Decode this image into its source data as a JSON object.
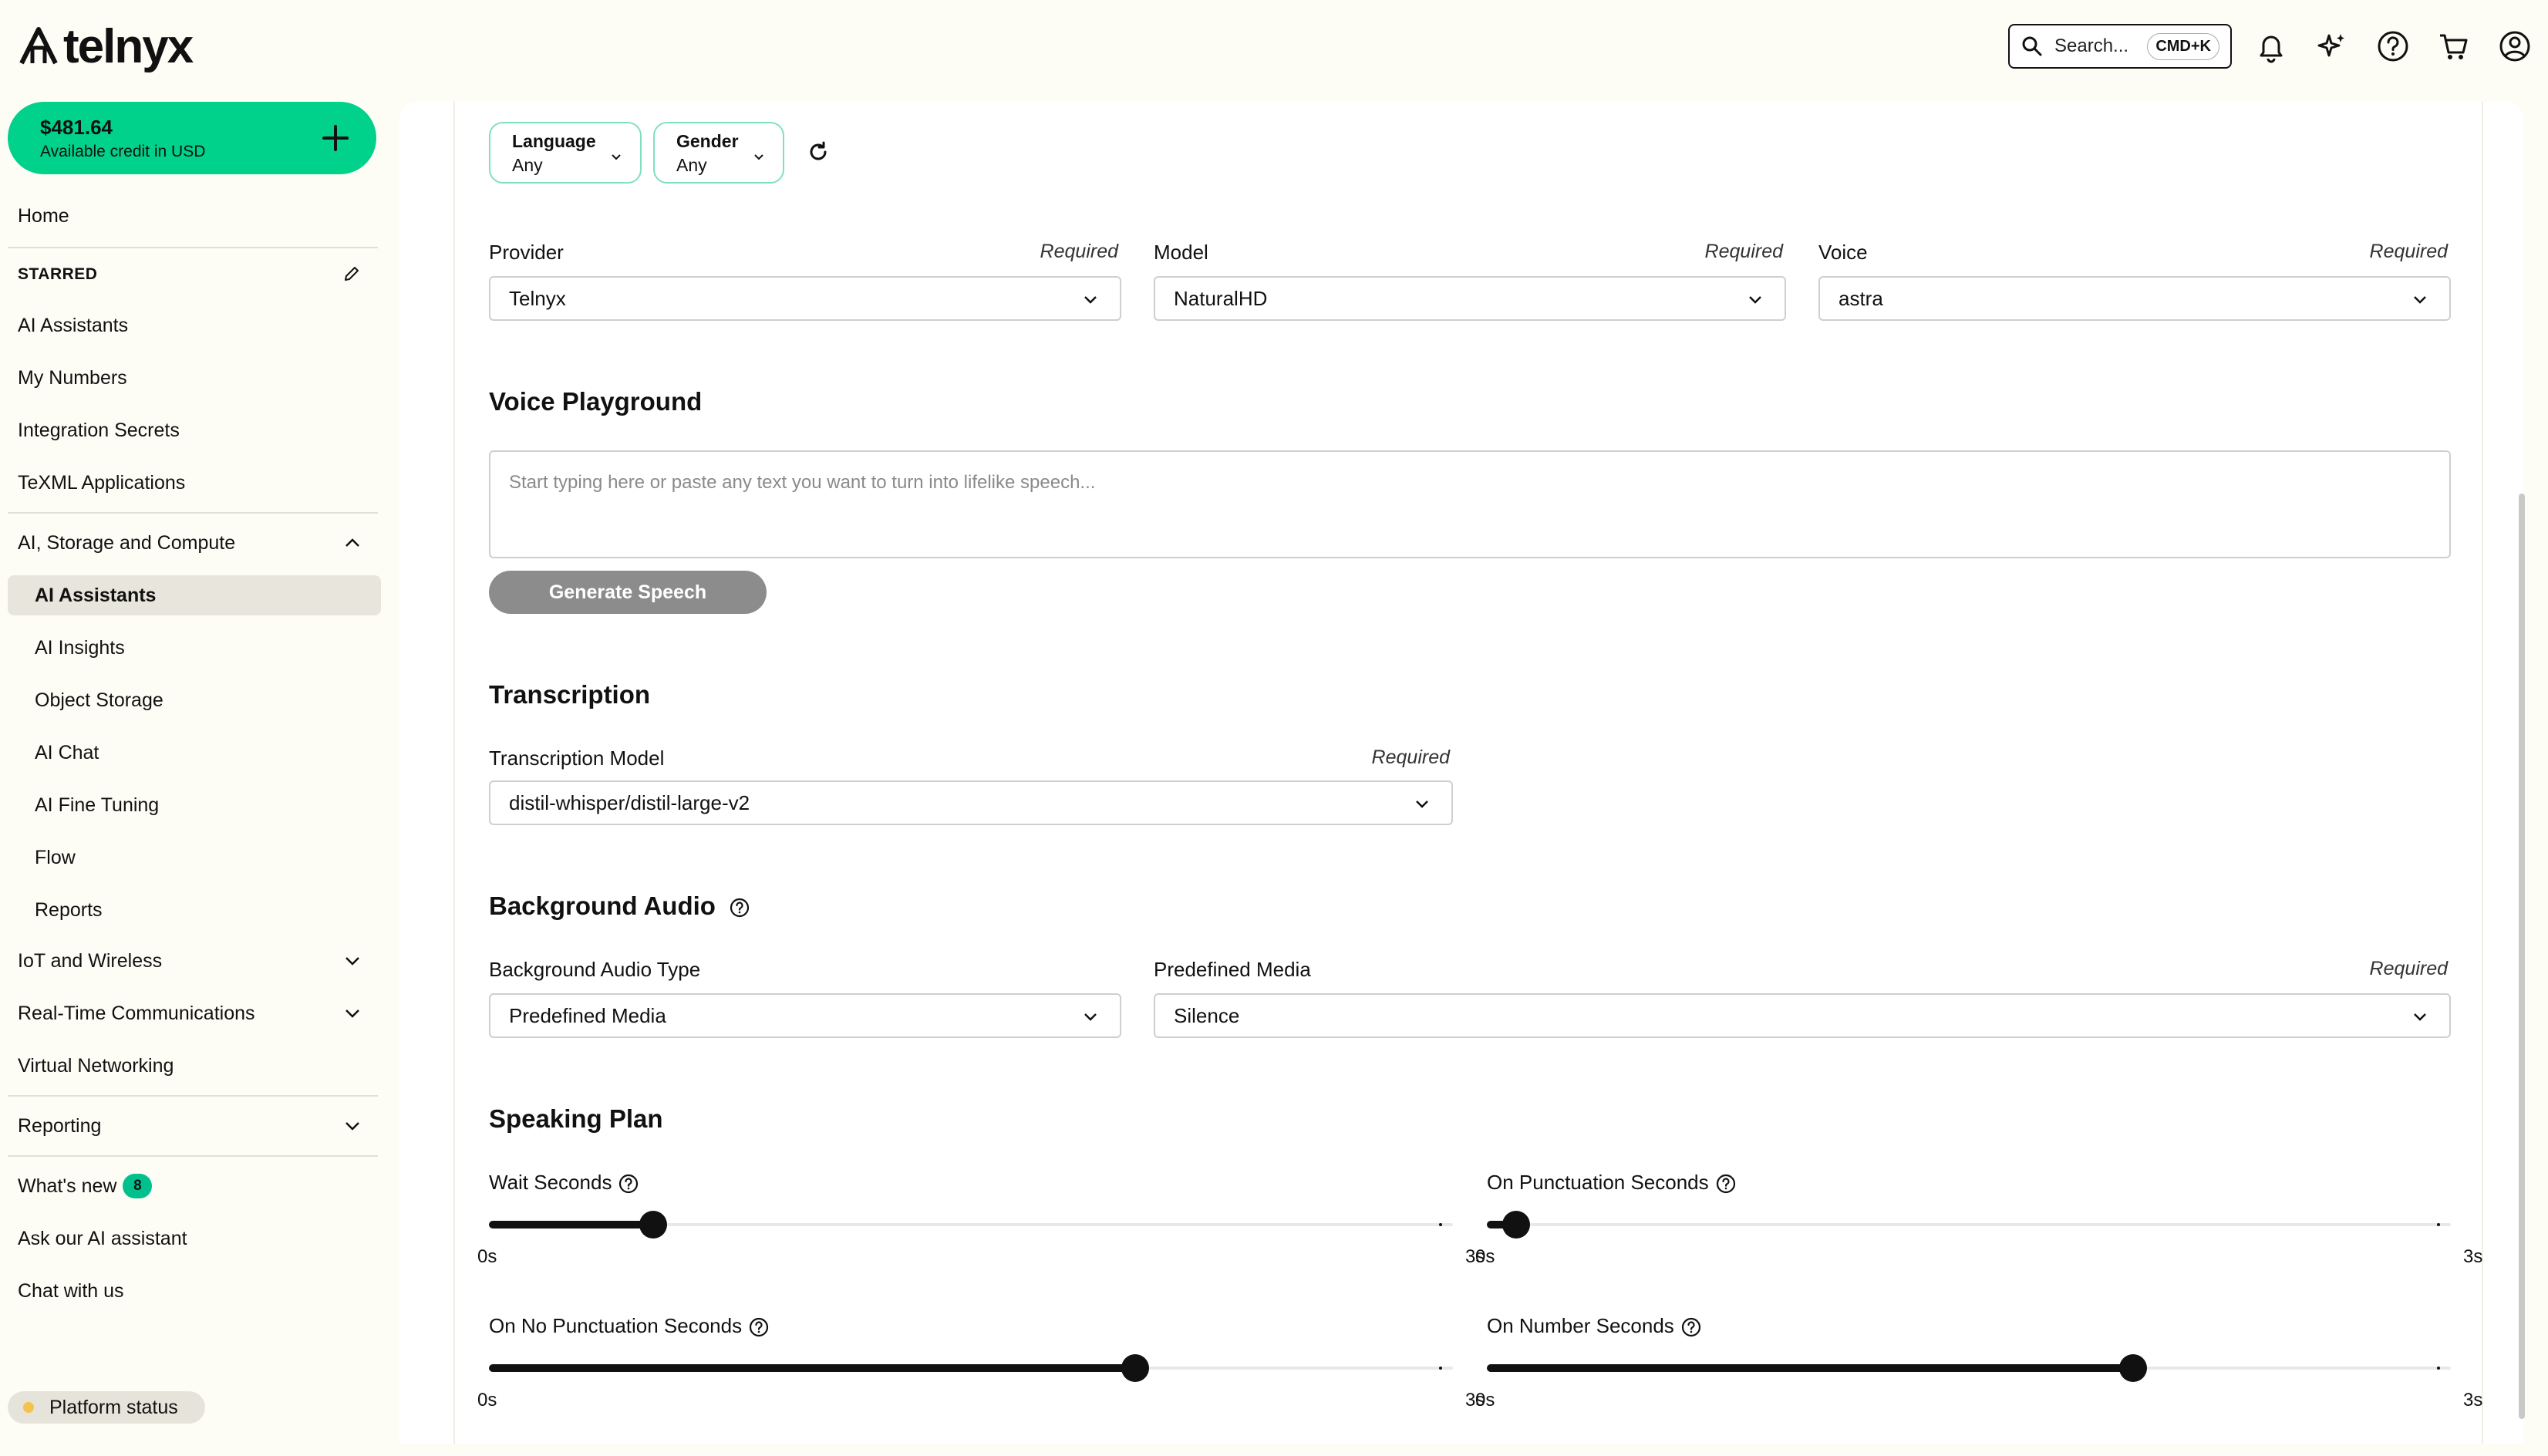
{
  "brand": {
    "name": "telnyx"
  },
  "search": {
    "placeholder": "Search...",
    "shortcut": "CMD+K"
  },
  "credit": {
    "amount": "$481.64",
    "label": "Available credit in USD"
  },
  "sidebar": {
    "home": "Home",
    "starred_title": "STARRED",
    "starred": [
      "AI Assistants",
      "My Numbers",
      "Integration Secrets",
      "TeXML Applications"
    ],
    "group_ai": "AI, Storage and Compute",
    "ai_items": [
      "AI Assistants",
      "AI Insights",
      "Object Storage",
      "AI Chat",
      "AI Fine Tuning",
      "Flow",
      "Reports"
    ],
    "iot": "IoT and Wireless",
    "rtc": "Real-Time Communications",
    "vnet": "Virtual Networking",
    "reporting": "Reporting",
    "whats_new": "What's new",
    "whats_new_count": "8",
    "ask_ai": "Ask our AI assistant",
    "chat": "Chat with us",
    "platform_status": "Platform status"
  },
  "filters": {
    "language": {
      "title": "Language",
      "value": "Any"
    },
    "gender": {
      "title": "Gender",
      "value": "Any"
    }
  },
  "voice": {
    "provider_label": "Provider",
    "provider_value": "Telnyx",
    "model_label": "Model",
    "model_value": "NaturalHD",
    "voice_label": "Voice",
    "voice_value": "astra",
    "required": "Required"
  },
  "playground": {
    "title": "Voice Playground",
    "placeholder": "Start typing here or paste any text you want to turn into lifelike speech...",
    "button": "Generate Speech"
  },
  "transcription": {
    "title": "Transcription",
    "model_label": "Transcription Model",
    "model_value": "distil-whisper/distil-large-v2",
    "required": "Required"
  },
  "background_audio": {
    "title": "Background Audio",
    "type_label": "Background Audio Type",
    "type_value": "Predefined Media",
    "media_label": "Predefined Media",
    "media_value": "Silence",
    "required": "Required"
  },
  "speaking_plan": {
    "title": "Speaking Plan",
    "sliders": [
      {
        "label": "Wait Seconds",
        "min": "0s",
        "max": "3s",
        "fraction": 0.17
      },
      {
        "label": "On Punctuation Seconds",
        "min": "0s",
        "max": "3s",
        "fraction": 0.03
      },
      {
        "label": "On No Punctuation Seconds",
        "min": "0s",
        "max": "3s",
        "fraction": 0.67
      },
      {
        "label": "On Number Seconds",
        "min": "0s",
        "max": "3s",
        "fraction": 0.67
      }
    ]
  },
  "colors": {
    "accent": "#00d18b",
    "badge": "#00c08b",
    "status_dot": "#f5c24c"
  }
}
